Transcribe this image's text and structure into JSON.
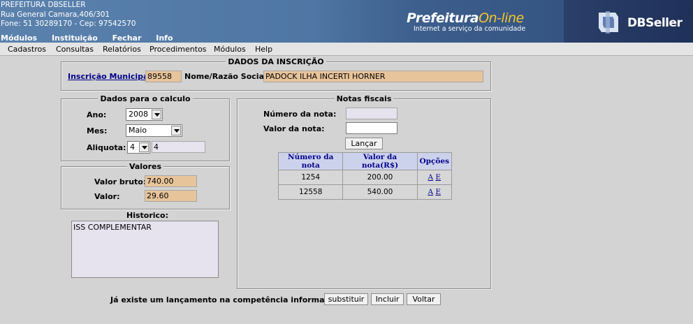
{
  "header": {
    "org_name": "PREFEITURA DBSELLER",
    "address": "Rua General Camara,406/301",
    "contact": "Fone: 51 30289170  -  Cep: 97542570",
    "menu": [
      "Módulos",
      "Instituição",
      "Fechar",
      "Info"
    ],
    "portal_title_a": "Prefeitura",
    "portal_title_b": "On-line",
    "portal_subtitle": "Internet a serviço da comunidade",
    "brand": "DBSeller"
  },
  "menubar": [
    "Cadastros",
    "Consultas",
    "Relatórios",
    "Procedimentos",
    "Módulos",
    "Help"
  ],
  "inscricao": {
    "legend": "DADOS DA INSCRIÇÃO",
    "inscricao_label": "Inscrição Municipal:",
    "inscricao_value": "89558",
    "nome_label": "Nome/Razão Social:",
    "nome_value": "PADOCK ILHA INCERTI HORNER"
  },
  "calculo": {
    "legend": "Dados para o calculo",
    "ano_label": "Ano:",
    "ano_value": "2008",
    "mes_label": "Mes:",
    "mes_value": "Maio",
    "aliquota_label": "Aliquota:",
    "aliquota_select": "4",
    "aliquota_value": "4"
  },
  "valores": {
    "legend": "Valores",
    "bruto_label": "Valor bruto:",
    "bruto_value": "740.00",
    "valor_label": "Valor:",
    "valor_value": "29.60"
  },
  "historico": {
    "label": "Historico:",
    "value": "ISS COMPLEMENTAR"
  },
  "notas": {
    "legend": "Notas fiscais",
    "numero_label": "Número da nota:",
    "numero_value": "",
    "valor_label": "Valor da nota:",
    "valor_value": "",
    "lancar_button": "Lançar",
    "columns": [
      "Número da nota",
      "Valor da nota(R$)",
      "Opções"
    ],
    "rows": [
      {
        "numero": "1254",
        "valor": "200.00",
        "alterar": "A",
        "excluir": "E"
      },
      {
        "numero": "12558",
        "valor": "540.00",
        "alterar": "A",
        "excluir": "E"
      }
    ]
  },
  "footer": {
    "message": "Já existe um lançamento na competência informada!!",
    "substituir_button": "substituir",
    "incluir_button": "Incluir",
    "voltar_button": "Voltar"
  },
  "colors": {
    "header_blue": "#4f76a4",
    "readonly_field": "#e8c49b",
    "link": "#00008b",
    "accent_yellow": "#f4c52e"
  }
}
